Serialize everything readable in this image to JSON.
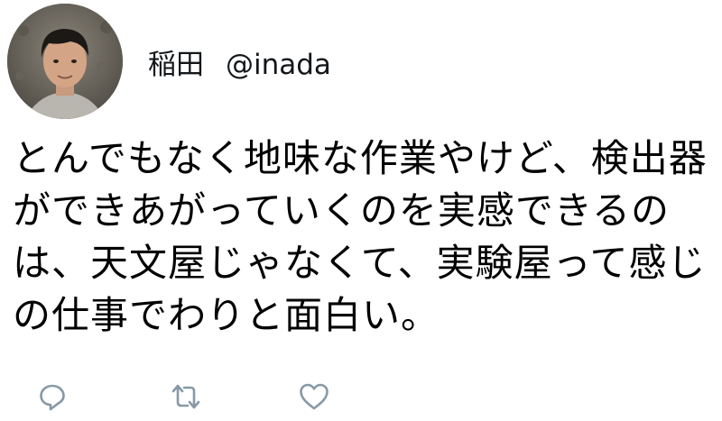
{
  "tweet": {
    "author": {
      "display_name": "稲田",
      "handle": "@inada",
      "avatar_icon": "avatar-photo"
    },
    "text": "とんでもなく地味な作業やけど、検出器ができあがっていくのを実感できるのは、天文屋じゃなくて、実験屋って感じの仕事でわりと面白い。",
    "actions": {
      "reply_icon": "reply-icon",
      "retweet_icon": "retweet-icon",
      "like_icon": "heart-icon"
    }
  },
  "colors": {
    "text": "#000000",
    "icon": "#8899a6",
    "background": "#ffffff"
  }
}
